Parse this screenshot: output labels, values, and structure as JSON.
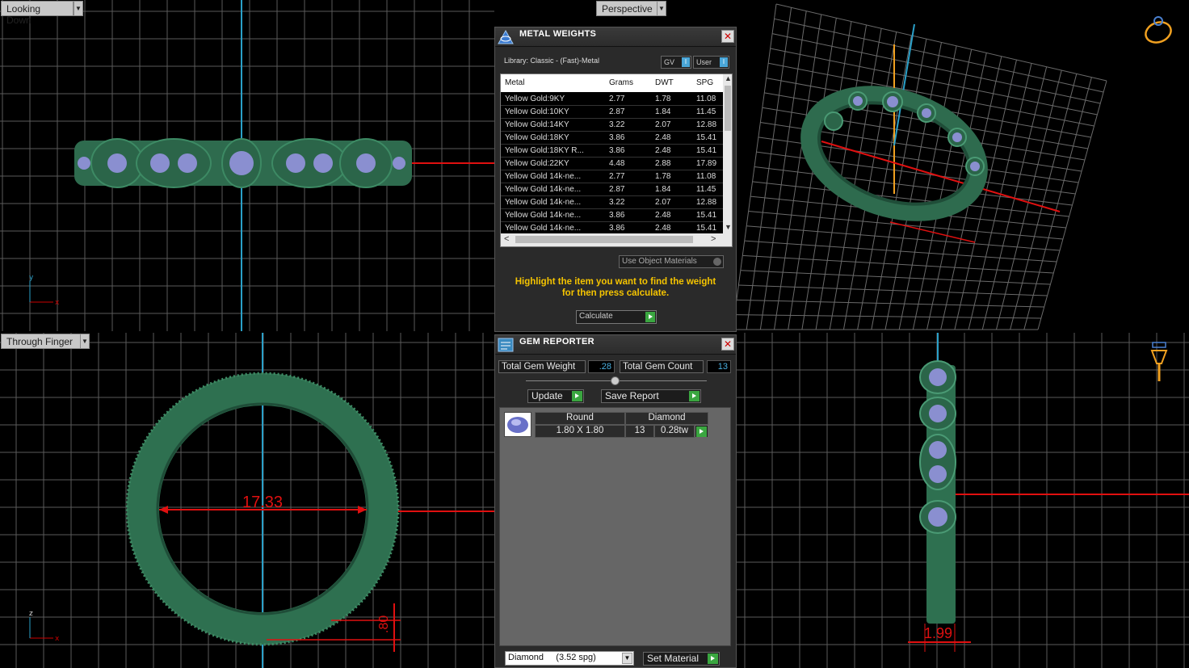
{
  "viewports": {
    "top_left": {
      "label": "Looking Down"
    },
    "top_right": {
      "label": "Perspective"
    },
    "bottom_left": {
      "label": "Through Finger",
      "dimension_main": "17.33",
      "dimension_small": ".80"
    },
    "bottom_right": {
      "dimension_small": "1.99"
    }
  },
  "metal_weights": {
    "title": "METAL WEIGHTS",
    "library": "Library: Classic - (Fast)-Metal",
    "toggle_gv": "GV",
    "toggle_user": "User",
    "columns": [
      "Metal",
      "Grams",
      "DWT",
      "SPG"
    ],
    "rows": [
      [
        "Yellow Gold:9KY",
        "2.77",
        "1.78",
        "11.08"
      ],
      [
        "Yellow Gold:10KY",
        "2.87",
        "1.84",
        "11.45"
      ],
      [
        "Yellow Gold:14KY",
        "3.22",
        "2.07",
        "12.88"
      ],
      [
        "Yellow Gold:18KY",
        "3.86",
        "2.48",
        "15.41"
      ],
      [
        "Yellow Gold:18KY R...",
        "3.86",
        "2.48",
        "15.41"
      ],
      [
        "Yellow Gold:22KY",
        "4.48",
        "2.88",
        "17.89"
      ],
      [
        "Yellow Gold 14k-ne...",
        "2.77",
        "1.78",
        "11.08"
      ],
      [
        "Yellow Gold 14k-ne...",
        "2.87",
        "1.84",
        "11.45"
      ],
      [
        "Yellow Gold 14k-ne...",
        "3.22",
        "2.07",
        "12.88"
      ],
      [
        "Yellow Gold 14k-ne...",
        "3.86",
        "2.48",
        "15.41"
      ],
      [
        "Yellow Gold 14k-ne...",
        "3.86",
        "2.48",
        "15.41"
      ]
    ],
    "use_object_materials": "Use Object Materials",
    "hint_line1": "Highlight the item you want to find the weight",
    "hint_line2": "for then press calculate.",
    "calculate_label": "Calculate"
  },
  "gem_reporter": {
    "title": "GEM REPORTER",
    "total_weight_label": "Total Gem Weight",
    "total_weight_value": ".28",
    "total_count_label": "Total Gem Count",
    "total_count_value": "13",
    "update_label": "Update",
    "save_report_label": "Save Report",
    "gems": [
      {
        "shape": "Round",
        "material": "Diamond",
        "size": "1.80 X 1.80",
        "count": "13",
        "weight": "0.28tw"
      }
    ],
    "material_select": "Diamond     (3.52 spg)",
    "set_material_label": "Set Material"
  },
  "colors": {
    "ring_green": "#2e6b4e",
    "gem_blue": "#8a8fd0",
    "grid": "#5a5a5a",
    "axis_red": "#e01010",
    "axis_blue": "#2aa0c8",
    "hint_yellow": "#f5c400"
  }
}
